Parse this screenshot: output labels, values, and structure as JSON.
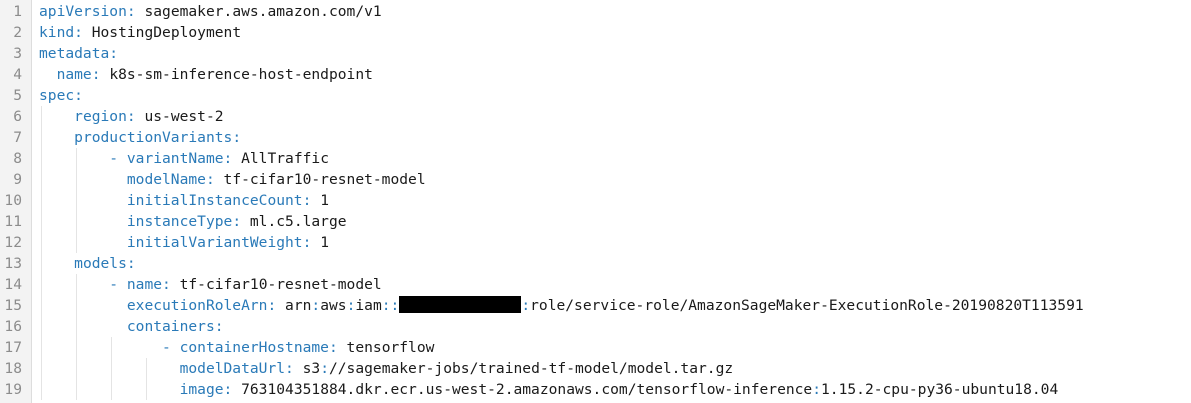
{
  "colors": {
    "key": "#2a7ab8",
    "value": "#1a1a1a",
    "line_number": "#8c8c8c",
    "gutter_bg": "#f3f3f3",
    "redaction": "#000000"
  },
  "lines": [
    {
      "n": "1",
      "indent": "",
      "dash": "",
      "key": "apiVersion",
      "value": " sagemaker.aws.amazon.com/v1"
    },
    {
      "n": "2",
      "indent": "",
      "dash": "",
      "key": "kind",
      "value": " HostingDeployment"
    },
    {
      "n": "3",
      "indent": "",
      "dash": "",
      "key": "metadata",
      "value": ""
    },
    {
      "n": "4",
      "indent": "  ",
      "dash": "",
      "key": "name",
      "value": " k8s-sm-inference-host-endpoint"
    },
    {
      "n": "5",
      "indent": "",
      "dash": "",
      "key": "spec",
      "value": ""
    },
    {
      "n": "6",
      "indent": "    ",
      "dash": "",
      "key": "region",
      "value": " us-west-2"
    },
    {
      "n": "7",
      "indent": "    ",
      "dash": "",
      "key": "productionVariants",
      "value": ""
    },
    {
      "n": "8",
      "indent": "        ",
      "dash": "- ",
      "key": "variantName",
      "value": " AllTraffic"
    },
    {
      "n": "9",
      "indent": "          ",
      "dash": "",
      "key": "modelName",
      "value": " tf-cifar10-resnet-model"
    },
    {
      "n": "10",
      "indent": "          ",
      "dash": "",
      "key": "initialInstanceCount",
      "value": " 1"
    },
    {
      "n": "11",
      "indent": "          ",
      "dash": "",
      "key": "instanceType",
      "value": " ml.c5.large"
    },
    {
      "n": "12",
      "indent": "          ",
      "dash": "",
      "key": "initialVariantWeight",
      "value": " 1"
    },
    {
      "n": "13",
      "indent": "    ",
      "dash": "",
      "key": "models",
      "value": ""
    },
    {
      "n": "14",
      "indent": "        ",
      "dash": "- ",
      "key": "name",
      "value": " tf-cifar10-resnet-model"
    },
    {
      "n": "15",
      "indent": "          ",
      "dash": "",
      "key": "executionRoleArn",
      "value": " arn:aws:iam::",
      "redacted": true,
      "value_after": ":role/service-role/AmazonSageMaker-ExecutionRole-20190820T113591"
    },
    {
      "n": "16",
      "indent": "          ",
      "dash": "",
      "key": "containers",
      "value": ""
    },
    {
      "n": "17",
      "indent": "              ",
      "dash": "- ",
      "key": "containerHostname",
      "value": " tensorflow"
    },
    {
      "n": "18",
      "indent": "                ",
      "dash": "",
      "key": "modelDataUrl",
      "value": " s3://sagemaker-jobs/trained-tf-model/model.tar.gz"
    },
    {
      "n": "19",
      "indent": "                ",
      "dash": "",
      "key": "image",
      "value": " 763104351884.dkr.ecr.us-west-2.amazonaws.com/tensorflow-inference:1.15.2-cpu-py36-ubuntu18.04"
    }
  ]
}
